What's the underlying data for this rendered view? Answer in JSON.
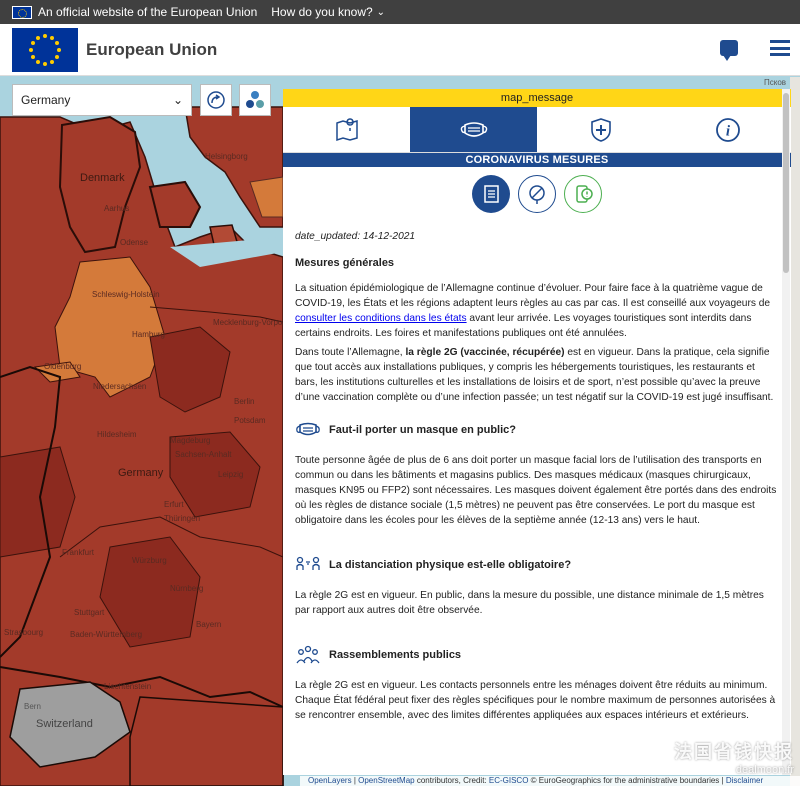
{
  "eu_strip": {
    "official_text": "An official website of the European Union",
    "how_text": "How do you know?"
  },
  "header": {
    "title": "European Union"
  },
  "map": {
    "country_selected": "Germany",
    "labels": {
      "denmark": "Denmark",
      "germany": "Germany",
      "switzerland": "Switzerland",
      "helsingborg": "Helsingborg",
      "aarhus": "Aarhus",
      "odense": "Odense",
      "hamburg": "Hamburg",
      "schleswig": "Schleswig-Holstein",
      "mecklenburg": "Mecklenburg-Vorpommern",
      "oldenburg": "Oldenburg",
      "niedersachsen": "Niedersachsen",
      "hildesheim": "Hildesheim",
      "berlin": "Berlin",
      "potsdam": "Potsdam",
      "sachsen_anhalt": "Sachsen-Anhalt",
      "magdeburg": "Magdeburg",
      "leipzig": "Leipzig",
      "erfurt": "Erfurt",
      "thuringen": "Thüringen",
      "wurzburg": "Würzburg",
      "nurnberg": "Nürnberg",
      "stuttgart": "Stuttgart",
      "baden": "Baden-Württemberg",
      "bayern": "Bayern",
      "strasbourg": "Strasbourg",
      "liechtenstein": "Liechtenstein",
      "bern": "Bern",
      "frankfurt": "Frankfurt",
      "pskov": "Псков"
    }
  },
  "panel": {
    "message_bar": "map_message",
    "section_title": "CORONAVIRUS MESURES",
    "date_updated": "date_updated: 14-12-2021",
    "general_heading": "Mesures générales",
    "para1_before_link": "La situation épidémiologique de l’Allemagne continue d’évoluer. Pour faire face à la quatrième vague de COVID-19, les États et les régions adaptent leurs règles au cas par cas. Il est conseillé aux voyageurs de ",
    "para1_link": "consulter les conditions dans les états",
    "para1_after_link": " avant leur arrivée. Les voyages touristiques sont interdits dans certains endroits. Les foires et manifestations publiques ont été annulées.",
    "para2_before_bold": "Dans toute l’Allemagne, ",
    "para2_bold": "la règle 2G (vaccinée, récupérée)",
    "para2_after_bold": " est en vigueur. Dans la pratique, cela signifie que tout accès aux installations publiques, y compris les hébergements touristiques, les restaurants et bars, les institutions culturelles et les installations de loisirs et de sport, n’est possible qu’avec la preuve d’une vaccination complète ou d’une infection passée; un test négatif sur la COVID-19 est jugé insuffisant.",
    "mask_heading": "Faut-il porter un masque en public?",
    "mask_text": "Toute personne âgée de plus de 6 ans doit porter un masque facial lors de l’utilisation des transports en commun ou dans les bâtiments et magasins publics. Des masques médicaux (masques chirurgicaux, masques KN95 ou FFP2) sont nécessaires. Les masques doivent également être portés dans des endroits où les règles de distance sociale (1,5 mètres) ne peuvent pas être conservées. Le port du masque est obligatoire dans les écoles pour les élèves de la septième année (12-13 ans) vers le haut.",
    "distance_heading": "La distanciation physique est-elle obligatoire?",
    "distance_text": "La règle 2G est en vigueur. En public, dans la mesure du possible, une distance minimale de 1,5 mètres par rapport aux autres doit être observée.",
    "gatherings_heading": "Rassemblements publics",
    "gatherings_text": "La règle 2G est en vigueur. Les contacts personnels entre les ménages doivent être réduits au minimum. Chaque État fédéral peut fixer des règles spécifiques pour le nombre maximum de personnes autorisées à se rencontrer ensemble, avec des limites différentes appliquées aux espaces intérieurs et extérieurs."
  },
  "attribution": {
    "openlayers": "OpenLayers",
    "sep1": " | ",
    "osm": "OpenStreetMap",
    "contributors": " contributors, Credit: ",
    "ecgisco": "EC-GISCO",
    "eurogeo": " © EuroGeographics for the administrative boundaries | ",
    "disclaimer": "Disclaimer"
  },
  "watermark": {
    "cn": "法国省钱快报",
    "en": "dealmoon.fr"
  },
  "colors": {
    "eu_blue": "#003399",
    "eu_yellow": "#ffcc00",
    "primary": "#1f4b8f",
    "message_yellow": "#ffd617",
    "map_red": "#a33a2a",
    "map_orange": "#d47a3a",
    "map_dark": "#8c2a1f",
    "map_grey": "#9e9e9e",
    "sea": "#aad3df"
  },
  "icons": {
    "tab1": "map-pin-icon",
    "tab2": "mask-icon",
    "tab3": "health-shield-icon",
    "tab4": "info-icon",
    "sub1": "document-list-icon",
    "sub2": "forbidden-pin-icon",
    "sub3": "phone-alert-icon"
  }
}
